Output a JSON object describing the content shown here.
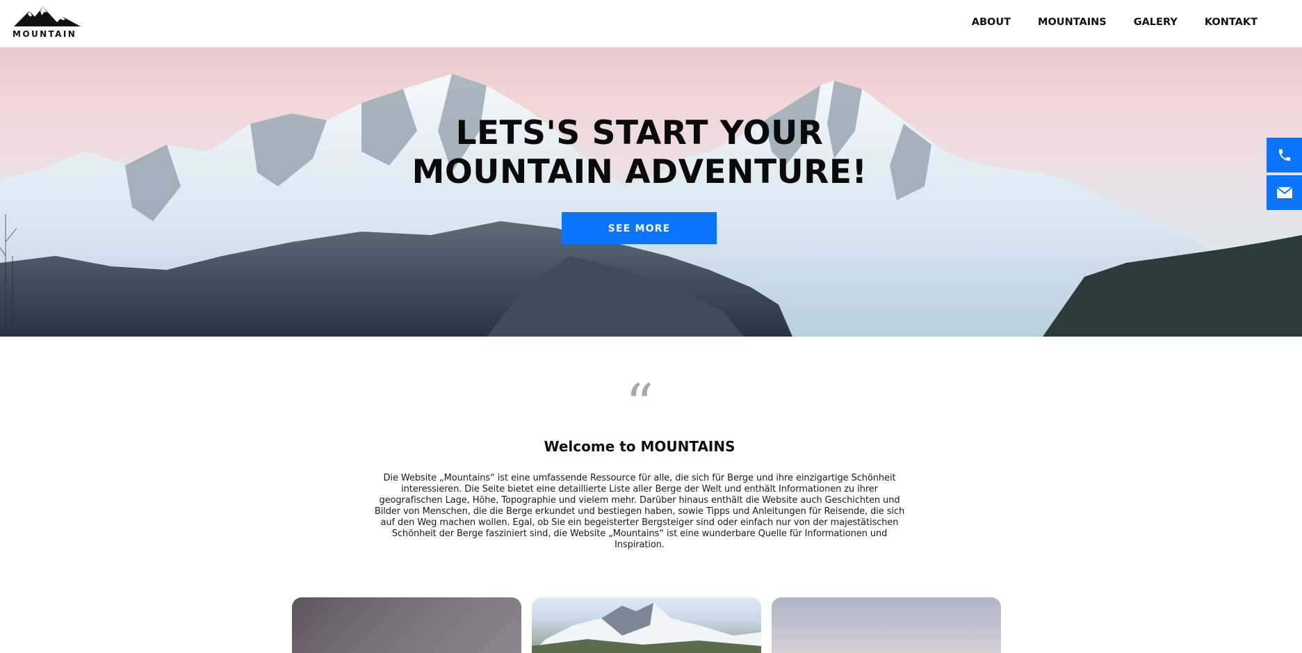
{
  "brand": {
    "logo_text": "MOUNTAIN",
    "logo_icon": "mountain-peaks-icon"
  },
  "nav": {
    "items": [
      {
        "label": "ABOUT"
      },
      {
        "label": "MOUNTAINS"
      },
      {
        "label": "GALERY"
      },
      {
        "label": "KONTAKT"
      }
    ]
  },
  "hero": {
    "title_line1": "LETS'S START YOUR",
    "title_line2": "MOUNTAIN ADVENTURE!",
    "cta_label": "SEE MORE",
    "background_image": "snowy-mountain-range-at-dawn"
  },
  "side_contact": {
    "phone_icon": "phone-icon",
    "mail_icon": "mail-icon"
  },
  "welcome": {
    "quote_glyph": "“",
    "title": "Welcome to MOUNTAINS",
    "body": "Die Website „Mountains“ ist eine umfassende Ressource für alle, die sich für Berge und ihre einzigartige Schönheit interessieren. Die Seite bietet eine detaillierte Liste aller Berge der Welt und enthält Informationen zu ihrer geografischen Lage, Höhe, Topographie und vielem mehr. Darüber hinaus enthält die Website auch Geschichten und Bilder von Menschen, die die Berge erkundet und bestiegen haben, sowie Tipps und Anleitungen für Reisende, die sich auf den Weg machen wollen. Egal, ob Sie ein begeisterter Bergsteiger sind oder einfach nur von der majestätischen Schönheit der Berge fasziniert sind, die Website „Mountains“ ist eine wunderbare Quelle für Informationen und Inspiration."
  },
  "colors": {
    "accent": "#0a74ff",
    "quote_grey": "#a9a9a9",
    "text": "#111111"
  }
}
